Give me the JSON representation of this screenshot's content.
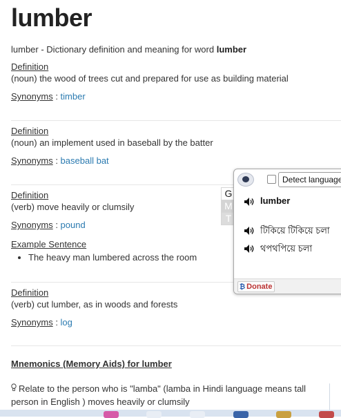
{
  "title": "lumber",
  "subtitle": {
    "prefix": "lumber - Dictionary definition and meaning for word ",
    "word": "lumber"
  },
  "labels": {
    "definition": "Definition",
    "synonyms": "Synonyms",
    "colon": " : ",
    "example_sentence": "Example Sentence"
  },
  "senses": [
    {
      "definition": "(noun) the wood of trees cut and prepared for use as building material",
      "synonyms": "timber"
    },
    {
      "definition": "(noun) an implement used in baseball by the batter",
      "synonyms": "baseball bat"
    },
    {
      "definition": "(verb) move heavily or clumsily",
      "synonyms": "pound",
      "example": "The heavy man lumbered across the room"
    },
    {
      "definition": "(verb) cut lumber, as in woods and forests",
      "synonyms": "log"
    }
  ],
  "mnemonics": {
    "title": "Mnemonics (Memory Aids) for lumber",
    "line1": "Relate to the person who is \"lamba\" (lamba in Hindi language means tall",
    "line2": "person in English ) moves heavily or clumsily"
  },
  "popup": {
    "detect_language": "Detect language",
    "source_word": "lumber",
    "translations": [
      "টিকিয়ে টিকিয়ে চলা",
      "থপথপিয়ে চলা"
    ],
    "donate": "Donate"
  },
  "gmt": [
    "G",
    "M",
    "T"
  ],
  "icons": {
    "owl": "owl-icon",
    "speaker": "speaker-icon",
    "bulb": "bulb-icon",
    "donate": "bitcoin-icon"
  },
  "colors": {
    "link": "#2a7ab0",
    "donate": "#bb3333"
  }
}
